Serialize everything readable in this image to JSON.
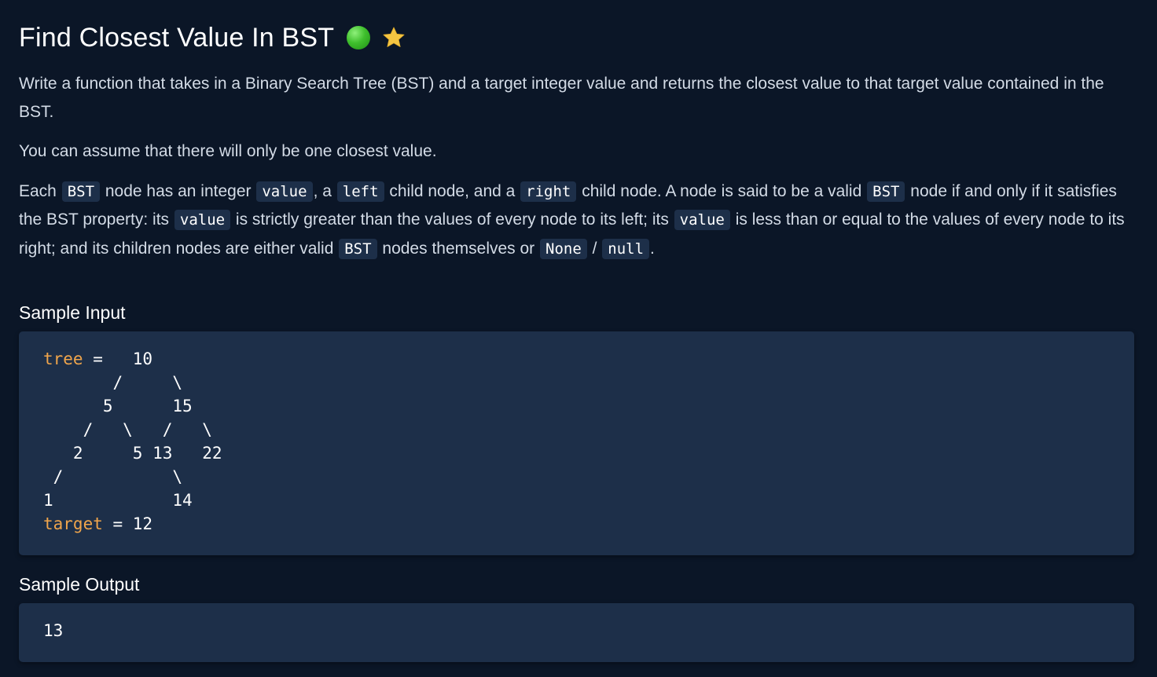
{
  "header": {
    "title": "Find Closest Value In BST",
    "difficulty_color": "#3fbf2d",
    "difficulty_icon": "green-circle-icon",
    "favorite_icon": "star-icon",
    "favorite_color": "#f5c542"
  },
  "description": {
    "p1": "Write a function that takes in a Binary Search Tree (BST) and a target integer value and returns the closest value to that target value contained in the BST.",
    "p2": "You can assume that there will only be one closest value.",
    "p3": {
      "t1": "Each ",
      "c1": "BST",
      "t2": " node has an integer ",
      "c2": "value",
      "t3": ", a ",
      "c3": "left",
      "t4": " child node, and a ",
      "c4": "right",
      "t5": " child node. A node is said to be a valid ",
      "c5": "BST",
      "t6": " node if and only if it satisfies the BST property: its ",
      "c6": "value",
      "t7": " is strictly greater than the values of every node to its left; its ",
      "c7": "value",
      "t8": " is less than or equal to the values of every node to its right; and its children nodes are either valid ",
      "c8": "BST",
      "t9": " nodes themselves or ",
      "c9": "None",
      "t10": " / ",
      "c10": "null",
      "t11": "."
    }
  },
  "sample_input": {
    "label": "Sample Input",
    "tree_keyword": "tree",
    "line0_rest": " =   10",
    "tree_lines": "       /     \\\n      5      15\n    /   \\   /   \\\n   2     5 13   22\n /           \\\n1            14",
    "target_keyword": "target",
    "target_rest": " = 12"
  },
  "sample_output": {
    "label": "Sample Output",
    "value": "13"
  }
}
